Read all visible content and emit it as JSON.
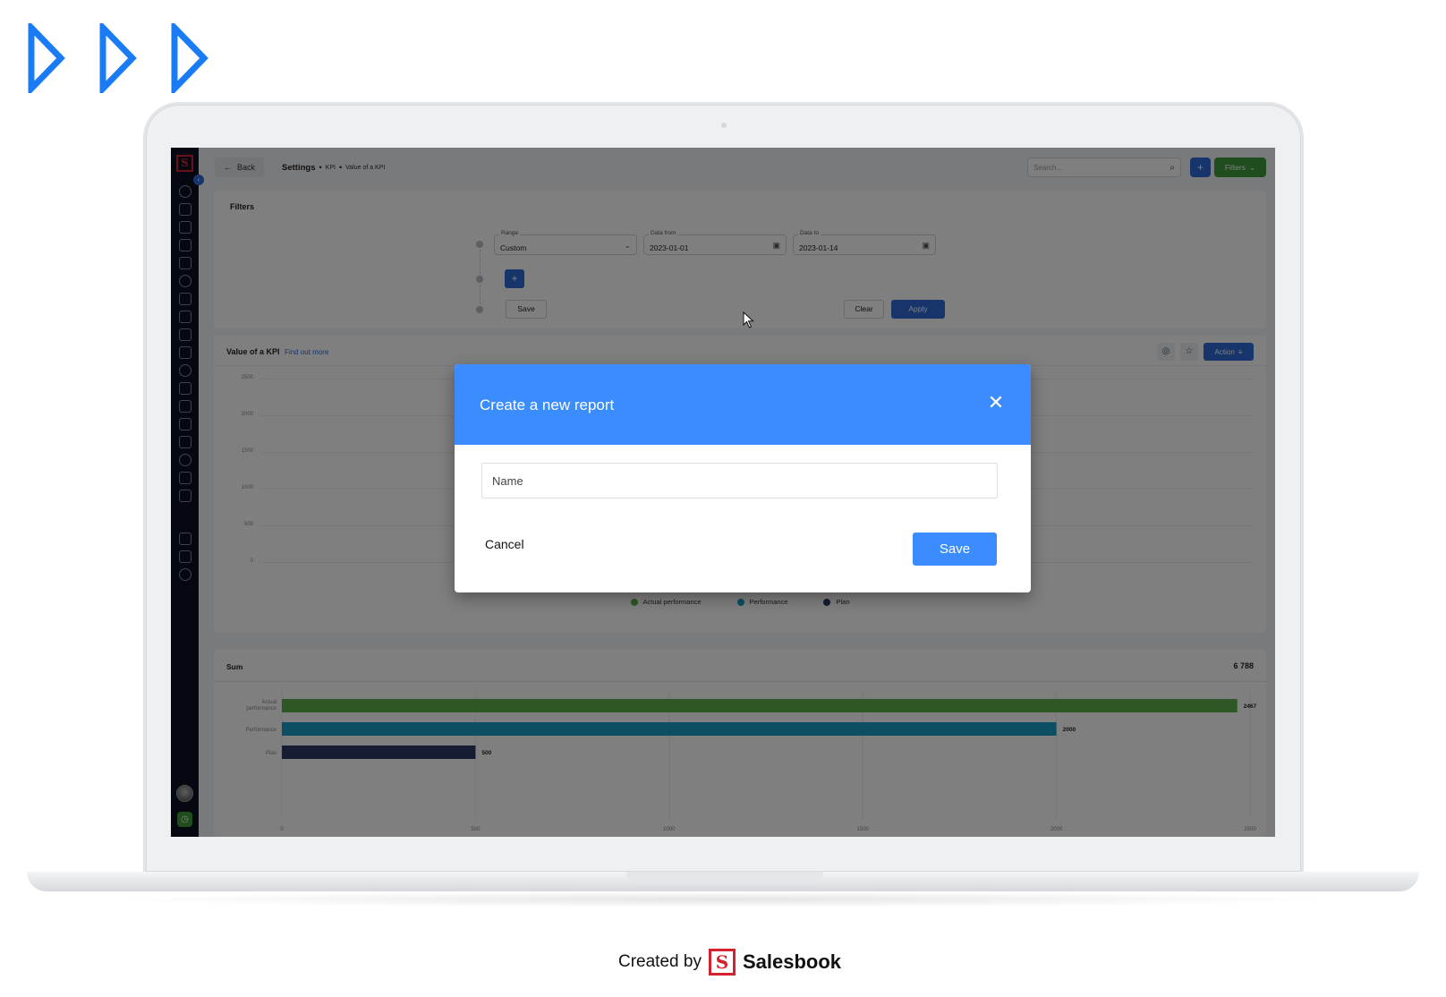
{
  "decoration": {
    "arrow_color": "#1a7cf5",
    "arrow_count": 3
  },
  "app": {
    "brand_letter": "S",
    "sidebar": {
      "collapse_icon": "chevron-left-icon",
      "items": [
        "percent-icon",
        "growth-chart-icon",
        "monitor-icon",
        "building-icon",
        "crm-icon",
        "document-edit-icon",
        "clipboard-check-icon",
        "calendar-icon",
        "folder-icon",
        "star-badge-icon",
        "gear-cog-icon",
        "solar-panel-icon",
        "car-icon",
        "send-icon",
        "chat-icon",
        "kpi-icon",
        "database-icon",
        "bell-icon",
        "users-icon",
        "graduation-cap-icon",
        "settings-icon"
      ]
    },
    "topbar": {
      "back_label": "Back",
      "breadcrumb": {
        "main": "Settings",
        "level2": "KPI",
        "level3": "Value of a KPI"
      },
      "search_placeholder": "Search...",
      "plus_label": "+",
      "filters_label": "Filters"
    },
    "filters": {
      "title": "Filters",
      "range": {
        "label": "Range",
        "value": "Custom"
      },
      "date_from": {
        "label": "Data from",
        "value": "2023-01-01"
      },
      "date_to": {
        "label": "Data to",
        "value": "2023-01-14"
      },
      "add_label": "+",
      "save_label": "Save",
      "clear_label": "Clear",
      "apply_label": "Apply"
    },
    "kpi": {
      "title": "Value of a KPI",
      "link": "Find out more",
      "action_label": "Action",
      "y_ticks": [
        "2500",
        "2000",
        "1500",
        "1000",
        "500",
        "0"
      ],
      "legend": [
        {
          "label": "Actual performance",
          "color": "#5bb04a"
        },
        {
          "label": "Performance",
          "color": "#1a9fc4"
        },
        {
          "label": "Plan",
          "color": "#2c3a66"
        }
      ]
    },
    "sum": {
      "title": "Sum",
      "total": "6 788"
    },
    "accent": "#2f6bd6",
    "success": "#3f9a3c"
  },
  "chart_data": {
    "type": "bar",
    "orientation": "horizontal",
    "title": "Sum",
    "categories": [
      "Actual performance",
      "Performance",
      "Plan"
    ],
    "values": [
      2467,
      2000,
      500
    ],
    "colors": [
      "#5bb04a",
      "#1a9fc4",
      "#2c3a66"
    ],
    "x_ticks": [
      0,
      500,
      1000,
      1500,
      2000,
      2500
    ],
    "xlim": [
      0,
      2500
    ],
    "grid": true
  },
  "modal": {
    "title": "Create a new report",
    "name_placeholder": "Name",
    "name_value": "",
    "cancel_label": "Cancel",
    "save_label": "Save",
    "header_color": "#3b8cff"
  },
  "footer": {
    "created_by": "Created by",
    "brand_letter": "S",
    "brand": "Salesbook"
  }
}
